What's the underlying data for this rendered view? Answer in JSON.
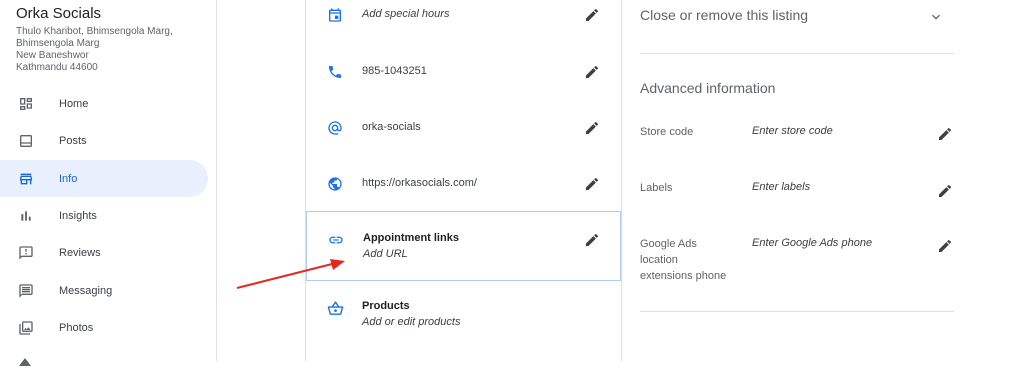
{
  "business": {
    "name": "Orka Socials",
    "address_lines": [
      "Thulo Kharibot, Bhimsengola Marg,",
      "Bhimsengola Marg",
      "New Baneshwor",
      "Kathmandu 44600"
    ]
  },
  "nav": {
    "items": [
      {
        "label": "Home",
        "icon": "dashboard-icon"
      },
      {
        "label": "Posts",
        "icon": "posts-icon"
      },
      {
        "label": "Info",
        "icon": "storefront-icon",
        "active": true
      },
      {
        "label": "Insights",
        "icon": "bar-chart-icon"
      },
      {
        "label": "Reviews",
        "icon": "reviews-icon"
      },
      {
        "label": "Messaging",
        "icon": "message-icon"
      },
      {
        "label": "Photos",
        "icon": "photo-icon"
      }
    ]
  },
  "info": {
    "special_hours": "Add special hours",
    "phone": "985-1043251",
    "short_name": "orka-socials",
    "website": "https://orkasocials.com/",
    "appointment_title": "Appointment links",
    "appointment_sub": "Add URL",
    "products_title": "Products",
    "products_sub": "Add or edit products"
  },
  "right": {
    "close_listing": "Close or remove this listing",
    "advanced_title": "Advanced information",
    "fields": [
      {
        "label": "Store code",
        "value": "Enter store code"
      },
      {
        "label": "Labels",
        "value": "Enter labels"
      },
      {
        "label": "Google Ads location extensions phone",
        "value": "Enter Google Ads phone"
      }
    ]
  },
  "colors": {
    "accent": "#1967d2",
    "active_bg": "#e8f0fe",
    "arrow": "#e8271f",
    "highlight_border": "#aecbfa"
  }
}
